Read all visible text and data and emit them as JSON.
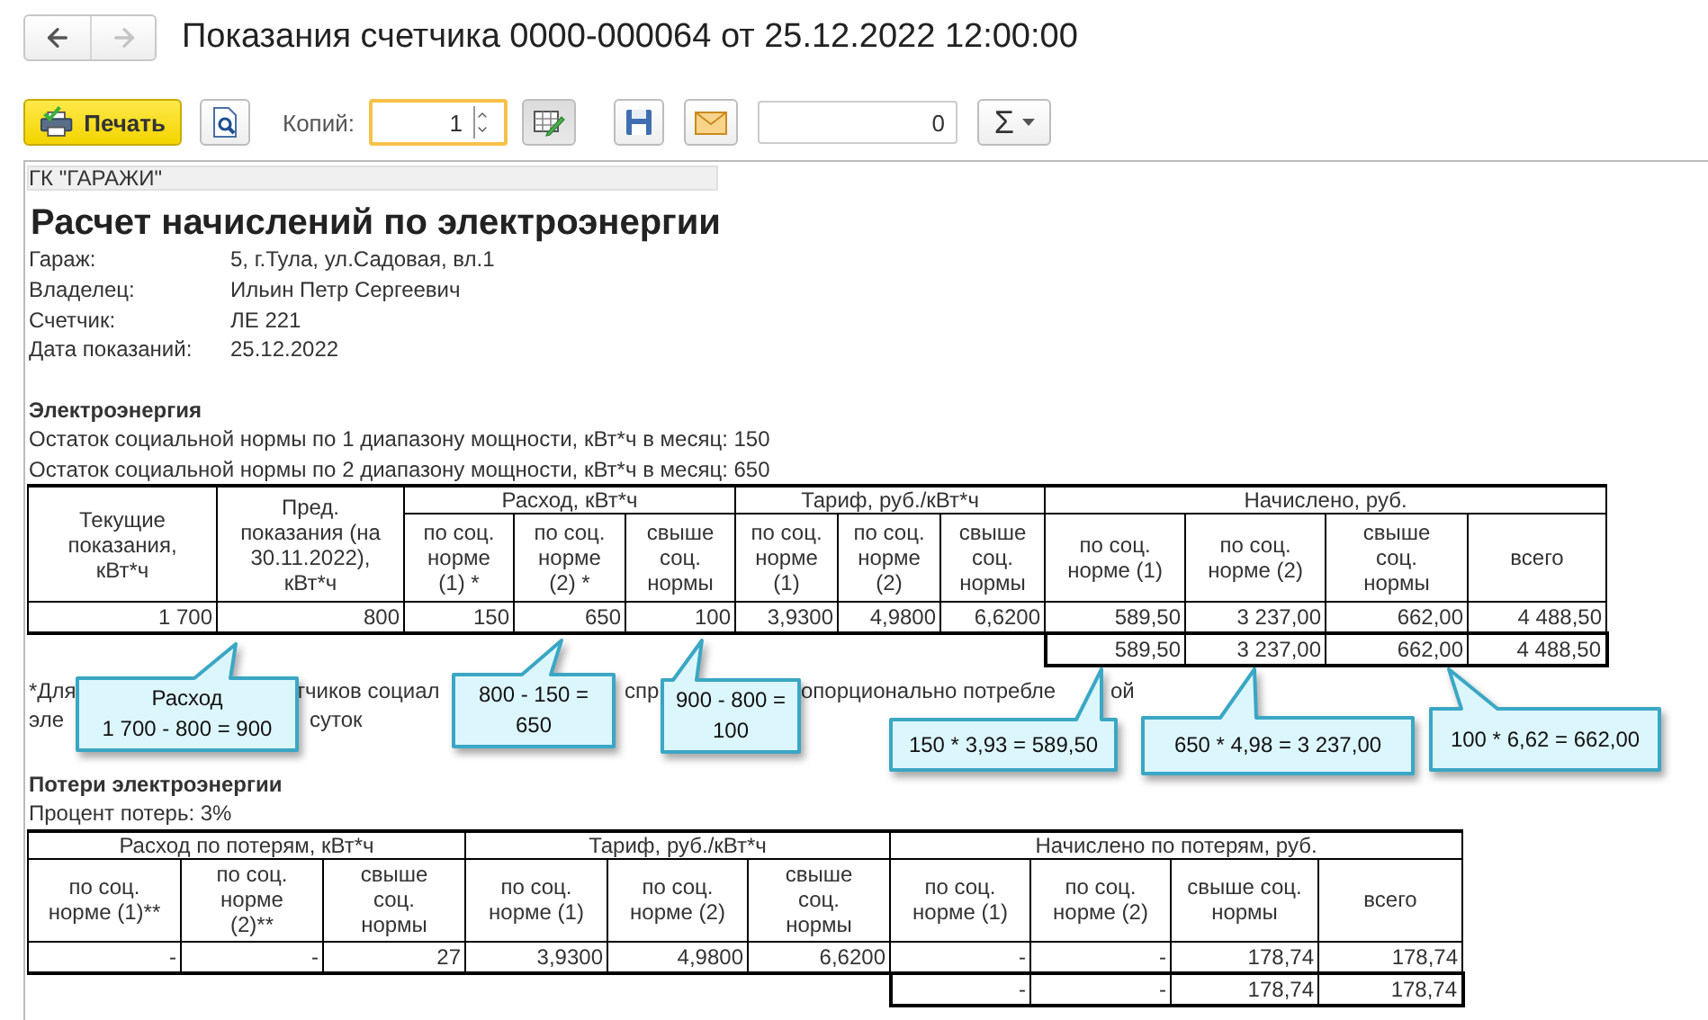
{
  "window": {
    "title": "Показания счетчика 0000-000064 от 25.12.2022 12:00:00"
  },
  "nav": {
    "back": {
      "disabled": false
    },
    "forward": {
      "disabled": true
    }
  },
  "toolbar": {
    "print_button": "Печать",
    "copies": {
      "label": "Копий:",
      "value": "1"
    },
    "edit_toggle": {
      "on": true
    },
    "amount_field": {
      "value": "0"
    },
    "sum_button": "Σ"
  },
  "report": {
    "organization": "ГК \"ГАРАЖИ\"",
    "title": "Расчет начислений по электроэнергии",
    "details": [
      {
        "label": "Гараж:",
        "value": "5, г.Тула, ул.Садовая, вл.1"
      },
      {
        "label": "Владелец:",
        "value": "Ильин Петр Сергеевич"
      },
      {
        "label": "Счетчик:",
        "value": "ЛЕ 221"
      },
      {
        "label": "Дата показаний:",
        "value": "25.12.2022"
      }
    ],
    "energy": {
      "heading": "Электроэнергия",
      "lines": [
        "Остаток социальной нормы по 1 диапазону мощности, кВт*ч в месяц: 150",
        "Остаток социальной нормы по 2 диапазону мощности, кВт*ч в месяц: 650"
      ]
    },
    "table1": {
      "column_groups": [
        {
          "label": "Расход, кВт*ч"
        },
        {
          "label": "Тариф, руб./кВт*ч"
        },
        {
          "label": "Начислено, руб."
        }
      ],
      "columns": [
        {
          "label": "Текущие показания, кВт*ч"
        },
        {
          "label": "Пред. показания (на 30.11.2022), кВт*ч"
        },
        {
          "label": "по соц. норме (1) *"
        },
        {
          "label": "по соц. норме (2) *"
        },
        {
          "label": "свыше соц. нормы"
        },
        {
          "label": "по соц. норме (1)"
        },
        {
          "label": "по соц. норме (2)"
        },
        {
          "label": "свыше соц. нормы"
        },
        {
          "label": "по соц. норме (1)"
        },
        {
          "label": "по соц. норме (2)"
        },
        {
          "label": "свыше соц. нормы"
        },
        {
          "label": "всего"
        }
      ],
      "rows": [
        [
          "1 700",
          "800",
          "150",
          "650",
          "100",
          "3,9300",
          "4,9800",
          "6,6200",
          "589,50",
          "3 237,00",
          "662,00",
          "4 488,50"
        ]
      ],
      "totals": [
        "589,50",
        "3 237,00",
        "662,00",
        "4 488,50"
      ]
    },
    "footnote": [
      [
        "*Для",
        "тчиков социал",
        "спр",
        "опорционально потребле",
        "ой"
      ],
      [
        "эле",
        "суток"
      ]
    ],
    "losses": {
      "heading": "Потери электроэнергии",
      "lines": [
        "Процент потерь: 3%"
      ]
    },
    "table2": {
      "column_groups": [
        {
          "label": "Расход по потерям, кВт*ч"
        },
        {
          "label": "Тариф, руб./кВт*ч"
        },
        {
          "label": "Начислено по потерям, руб."
        }
      ],
      "columns": [
        {
          "label": "по соц. норме (1)**"
        },
        {
          "label": "по соц. норме (2)**"
        },
        {
          "label": "свыше соц. нормы"
        },
        {
          "label": "по соц. норме (1)"
        },
        {
          "label": "по соц. норме (2)"
        },
        {
          "label": "свыше соц. нормы"
        },
        {
          "label": "по соц. норме (1)"
        },
        {
          "label": "по соц. норме (2)"
        },
        {
          "label": "свыше соц. нормы"
        },
        {
          "label": "всего"
        }
      ],
      "rows": [
        [
          "-",
          "-",
          "27",
          "3,9300",
          "4,9800",
          "6,6200",
          "-",
          "-",
          "178,74",
          "178,74"
        ]
      ],
      "totals": [
        "-",
        "-",
        "178,74",
        "178,74"
      ]
    },
    "callouts": [
      {
        "lines": [
          "Расход",
          "1 700 - 800 = 900"
        ]
      },
      {
        "lines": [
          "800 - 150 =",
          "650"
        ]
      },
      {
        "lines": [
          "900  - 800 =",
          "100"
        ]
      },
      {
        "lines": [
          "150 * 3,93 = 589,50"
        ]
      },
      {
        "lines": [
          "650 * 4,98 = 3 237,00"
        ]
      },
      {
        "lines": [
          "100 * 6,62 = 662,00"
        ]
      }
    ]
  }
}
